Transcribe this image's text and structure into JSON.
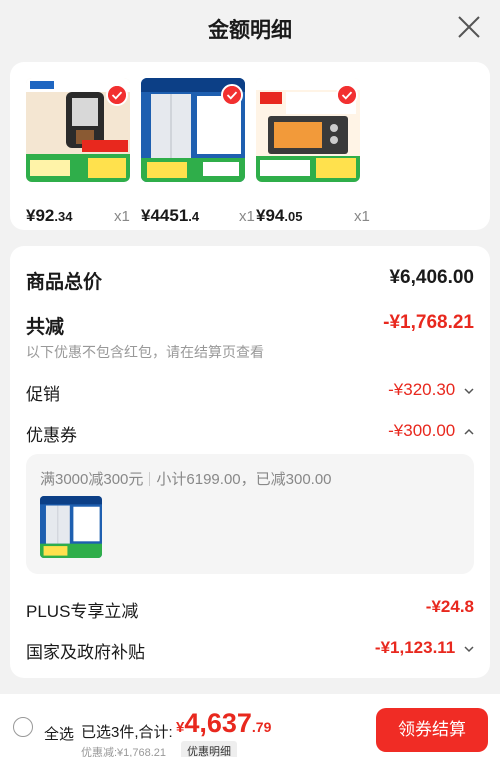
{
  "header": {
    "title": "金额明细",
    "close_icon": "close-icon"
  },
  "products": [
    {
      "name_hint": "Midea 咖啡机",
      "price_int": "¥92",
      "price_dec": ".34",
      "qty": "x1",
      "thumb_color": "#b8895b"
    },
    {
      "name_hint": "Midea 冰箱",
      "price_int": "¥4451",
      "price_dec": ".4",
      "qty": "x1",
      "thumb_color": "#2f6fbf"
    },
    {
      "name_hint": "Midea 电烤箱",
      "price_int": "¥94",
      "price_dec": ".05",
      "qty": "x1",
      "thumb_color": "#e86a2c"
    }
  ],
  "summary": {
    "total_label": "商品总价",
    "total_value": "¥6,406.00",
    "discount_label": "共减",
    "discount_value": "-¥1,768.21",
    "discount_note": "以下优惠不包含红包，请在结算页查看",
    "promo_label": "促销",
    "promo_value": "-¥320.30",
    "coupon_label": "优惠券",
    "coupon_value": "-¥300.00",
    "coupon_detail_rule": "满3000减300元",
    "coupon_detail_sub": "小计6199.00，已减300.00",
    "plus_label": "PLUS专享立减",
    "plus_value": "-¥24.8",
    "subsidy_label": "国家及政府补贴",
    "subsidy_value": "-¥1,123.11"
  },
  "footer": {
    "select_all": "全选",
    "selected": "已选3件,合计:",
    "total_cur": "¥",
    "total_int": "4,637",
    "total_dec": ".79",
    "saved": "优惠减:¥1,768.21",
    "detail_tag": "优惠明细",
    "checkout": "领券结算"
  },
  "colors": {
    "accent": "#e8281e",
    "button": "#f02c25"
  }
}
